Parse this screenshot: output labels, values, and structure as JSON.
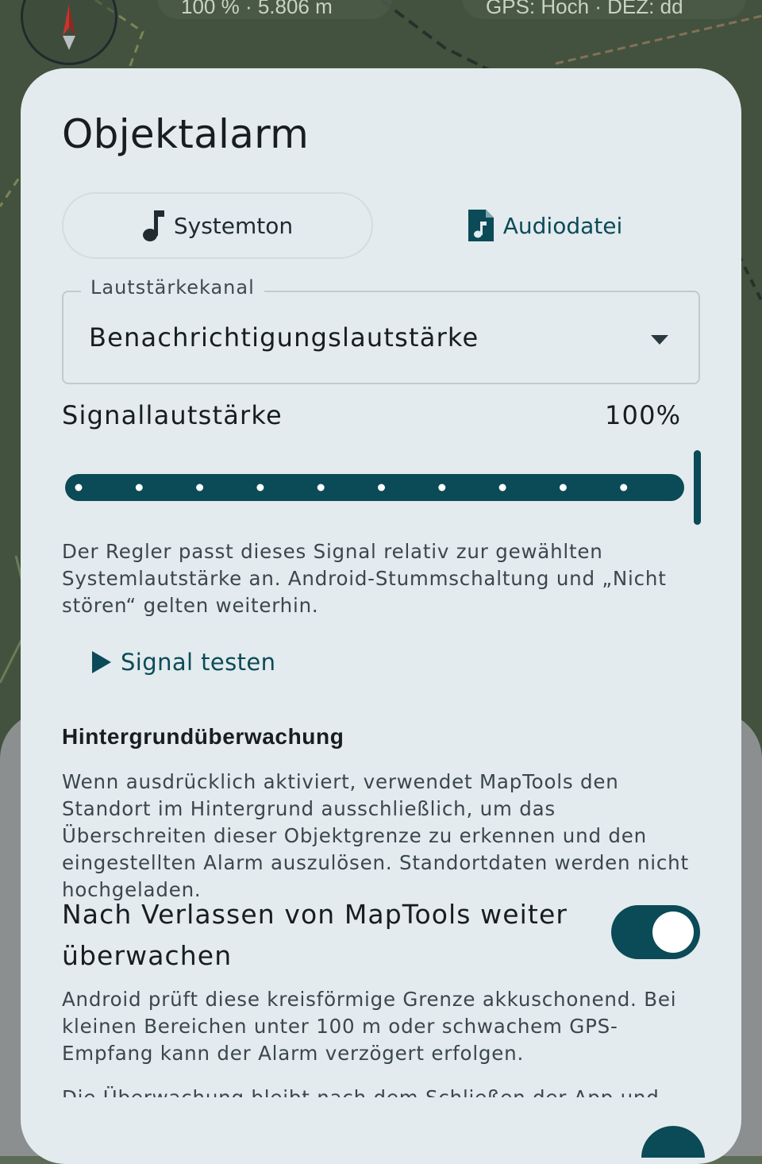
{
  "map": {
    "chip_left_text": "100 % · 5.806 m",
    "chip_right_text": "GPS: Hoch · DEZ: dd"
  },
  "dialog": {
    "title": "Objektalarm",
    "tabs": [
      {
        "label": "Systemton",
        "icon": "music-note-icon",
        "selected": false
      },
      {
        "label": "Audiodatei",
        "icon": "audio-file-icon",
        "selected": true
      }
    ],
    "volume_channel": {
      "label": "Lautstärkekanal",
      "value": "Benachrichtigungslautstärke"
    },
    "signal_volume": {
      "label": "Signallautstärke",
      "value_text": "100%",
      "value": 1.0,
      "steps": 10
    },
    "slider_help": "Der Regler passt dieses Signal relativ zur gewählten Systemlautstärke an. Android-Stummschaltung und „Nicht stören“ gelten weiterhin.",
    "test_button": "Signal testen",
    "background_section": {
      "title": "Hintergrundüberwachung",
      "description": "Wenn ausdrücklich aktiviert, verwendet MapTools den Standort im Hintergrund ausschließlich, um das Überschreiten dieser Objektgrenze zu erkennen und den eingestellten Alarm auszulösen. Standortdaten werden nicht hochgeladen.",
      "toggle_label": "Nach Verlassen von MapTools weiter überwachen",
      "toggle_on": true,
      "note": "Android prüft diese kreisförmige Grenze akkuschonend. Bei kleinen Bereichen unter 100 m oder schwachem GPS-Empfang kann der Alarm verzögert erfolgen.",
      "note_cutoff": "Die Überwachung bleibt nach dem Schließen der App und nach"
    }
  },
  "colors": {
    "accent": "#0b4a57",
    "dialog_bg": "#e3ebee",
    "text": "#171d20"
  }
}
